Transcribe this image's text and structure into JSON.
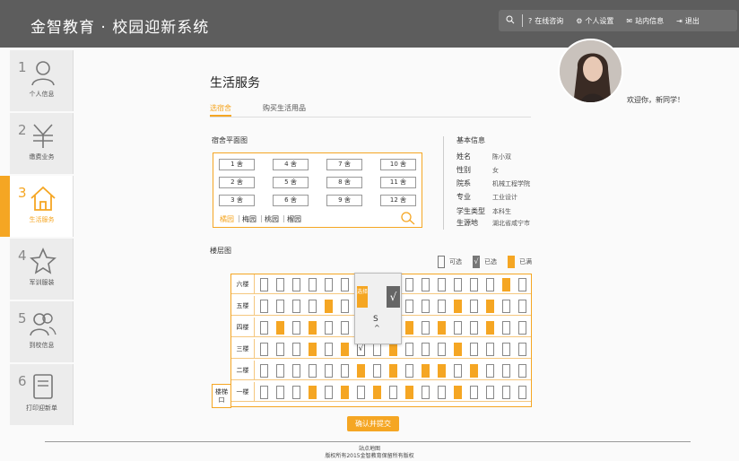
{
  "app": {
    "title": "金智教育 · 校园迎新系统"
  },
  "header": {
    "consult": "在线咨询",
    "settings": "个人设置",
    "messages": "站内信息",
    "logout": "退出"
  },
  "sidebar": {
    "items": [
      {
        "num": "1",
        "label": "个人信息",
        "icon": "user-icon"
      },
      {
        "num": "2",
        "label": "缴费业务",
        "icon": "yuan-icon"
      },
      {
        "num": "3",
        "label": "生活服务",
        "icon": "home-icon"
      },
      {
        "num": "4",
        "label": "军训服装",
        "icon": "star-icon"
      },
      {
        "num": "5",
        "label": "到校信息",
        "icon": "users-icon"
      },
      {
        "num": "6",
        "label": "打印迎新单",
        "icon": "document-icon"
      }
    ]
  },
  "main": {
    "title": "生活服务",
    "tabs": [
      "选宿舍",
      "购买生活用品"
    ],
    "dorm_plan_label": "宿舍平面图",
    "dorms": [
      "1 舍",
      "4 舍",
      "7 舍",
      "10 舍",
      "2 舍",
      "5 舍",
      "8 舍",
      "11 舍",
      "3 舍",
      "6 舍",
      "9 舍",
      "12 舍"
    ],
    "campuses": [
      "橘园",
      "梅园",
      "桃园",
      "榴园"
    ],
    "floor_label": "楼层图",
    "legend": {
      "available": "可选",
      "selected": "已选",
      "full": "已满"
    },
    "floors": [
      "六楼",
      "五楼",
      "四楼",
      "三楼",
      "二楼",
      "一楼"
    ],
    "stair_label": "楼梯口",
    "submit": "确认并提交"
  },
  "info": {
    "heading": "基本信息",
    "rows": [
      {
        "k": "姓名",
        "v": "陈小双"
      },
      {
        "k": "性别",
        "v": "女"
      },
      {
        "k": "院系",
        "v": "机械工程学院"
      },
      {
        "k": "专业",
        "v": "工业设计"
      },
      {
        "k": "学生类型",
        "v": "本科生"
      },
      {
        "k": "生源地",
        "v": "湖北省咸宁市"
      }
    ]
  },
  "welcome": "欢迎你，新同学！",
  "popup": {
    "selected": "选择",
    "check": "√",
    "s": "S",
    "up": "^"
  },
  "footer": {
    "line1": "站点地图",
    "line2": "版权所有2015金智教育保留所有版权"
  },
  "colors": {
    "accent": "#f5a623",
    "header": "#5d5d5d"
  }
}
